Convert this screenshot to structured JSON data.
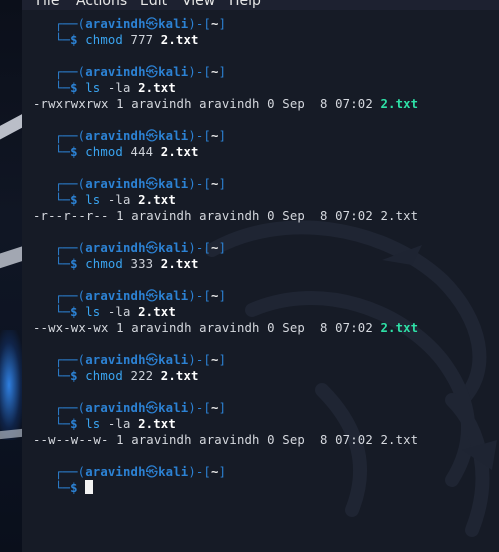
{
  "menu": [
    "File",
    "Actions",
    "Edit",
    "View",
    "Help"
  ],
  "prompt": {
    "user": "aravindh",
    "at": "㉿",
    "host": "kali",
    "path": "~"
  },
  "commands": [
    {
      "cmd": "chmod",
      "args": "777",
      "file": "2.txt"
    },
    {
      "cmd": "ls",
      "args": "-la",
      "file": "2.txt",
      "output": "-rwxrwxrwx 1 aravindh aravindh 0 Sep  8 07:02 ",
      "out_file": "2.txt",
      "out_file_color": "#2ee0a6"
    },
    {
      "cmd": "chmod",
      "args": "444",
      "file": "2.txt"
    },
    {
      "cmd": "ls",
      "args": "-la",
      "file": "2.txt",
      "output": "-r--r--r-- 1 aravindh aravindh 0 Sep  8 07:02 ",
      "out_file": "2.txt",
      "out_file_color": "#d6d9df"
    },
    {
      "cmd": "chmod",
      "args": "333",
      "file": "2.txt"
    },
    {
      "cmd": "ls",
      "args": "-la",
      "file": "2.txt",
      "output": "--wx-wx-wx 1 aravindh aravindh 0 Sep  8 07:02 ",
      "out_file": "2.txt",
      "out_file_color": "#2ee0a6"
    },
    {
      "cmd": "chmod",
      "args": "222",
      "file": "2.txt"
    },
    {
      "cmd": "ls",
      "args": "-la",
      "file": "2.txt",
      "output": "--w--w--w- 1 aravindh aravindh 0 Sep  8 07:02 ",
      "out_file": "2.txt",
      "out_file_color": "#d6d9df"
    }
  ],
  "colors": {
    "prompt_blue": "#2c82d4",
    "executable_green": "#2ee0a6",
    "terminal_bg": "#161b26"
  }
}
